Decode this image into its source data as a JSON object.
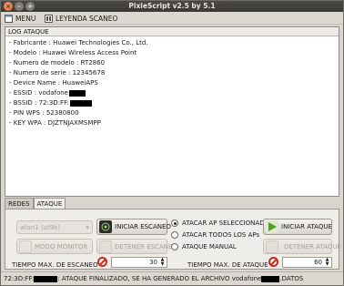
{
  "window": {
    "title": "PixieScript v2.5 by 5.1"
  },
  "menu": {
    "menu_label": "MENU",
    "legend_label": "LEYENDA SCANEO"
  },
  "log": {
    "header": "LOG ATAQUE",
    "lines": [
      "- Fabricante : Huawei Technologies Co., Ltd.",
      "- Modelo : Huawei Wireless Access Point",
      "- Numero de modelo : RT2860",
      "- Numero de serie : 12345678",
      "- Device Name : HuaweiAPS",
      "- ESSID : vodafone",
      "- BSSID : 72:3D:FF:",
      "- PIN WPS :  52380800",
      "- KEY WPA : DJZTNJAXMSMPP"
    ]
  },
  "tabs": [
    "REDES",
    "ATAQUE"
  ],
  "controls": {
    "combo_value": "wlan1 (at9k)",
    "modo_monitor": "MODO MONITOR",
    "iniciar_escaneo": "INICIAR ESCANEO",
    "detener_escaneo": "DETENER ESCANEO",
    "radio_options": [
      "ATACAR AP SELECCIONADO",
      "ATACAR TODOS LOS APs",
      "ATAQUE MANUAL"
    ],
    "radio_selected": 0,
    "iniciar_ataque": "INICIAR ATAQUE",
    "detener_ataque": "DETENER ATAQUE",
    "scan_time_value": "30",
    "attack_time_value": "60",
    "scan_time_label": "TIEMPO MAX. DE ESCANEO",
    "attack_time_label": "TIEMPO MAX. DE ATAQUE"
  },
  "status": {
    "prefix": "72:3D:FF:",
    "middle": " : ATAQUE FINALIZADO, SE HA GENERADO EL ARCHIVO vodafone",
    "suffix": ".DATOS"
  }
}
